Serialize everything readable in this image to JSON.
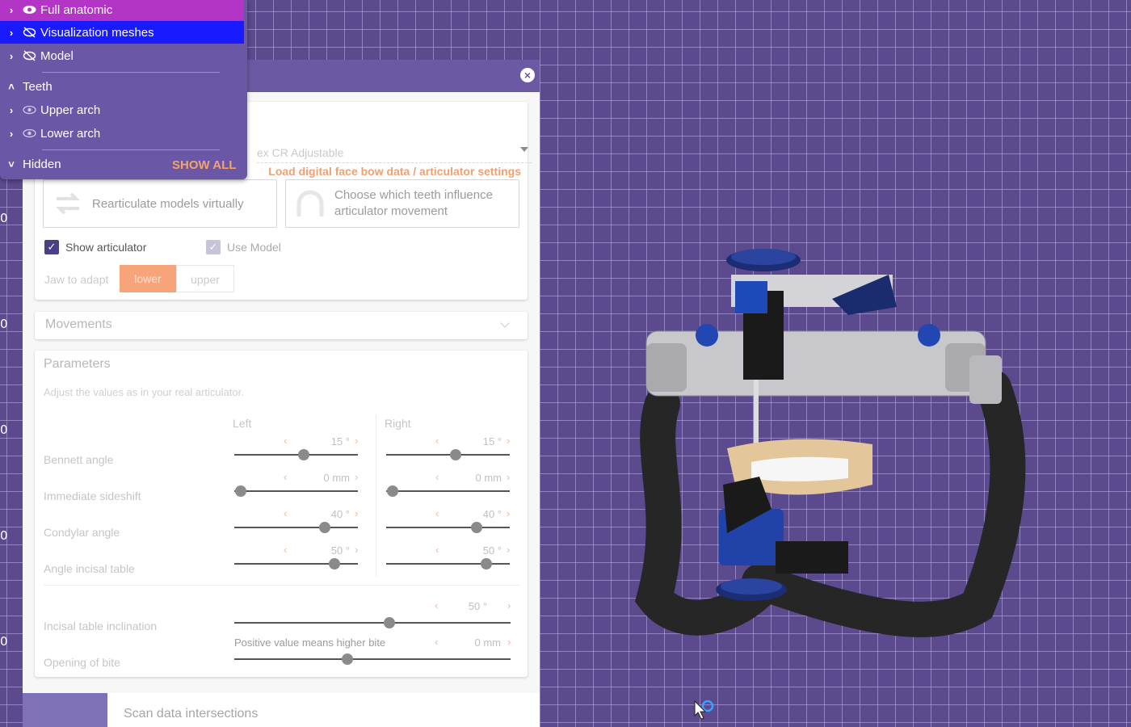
{
  "ruler_numbers": [
    "0",
    "0",
    "0",
    "0",
    "0"
  ],
  "menu": {
    "items": [
      {
        "label": "Full anatomic",
        "visible": true,
        "state": "magenta-highlight"
      },
      {
        "label": "Visualization meshes",
        "visible": false,
        "state": "selected"
      },
      {
        "label": "Model",
        "visible": false
      }
    ],
    "teeth_header": "Teeth",
    "teeth_items": [
      {
        "label": "Upper arch",
        "visible": true
      },
      {
        "label": "Lower arch",
        "visible": true
      }
    ],
    "hidden_header": "Hidden",
    "show_all": "SHOW ALL"
  },
  "panel": {
    "articulator_select": "ex CR Adjustable",
    "load_link": "Load digital face bow data / articulator settings",
    "rearticulate_button": "Rearticulate models virtually",
    "choose_teeth_button": "Choose which teeth influence articulator movement",
    "show_articulator": {
      "label": "Show articulator",
      "checked": true
    },
    "use_model": {
      "label": "Use Model",
      "checked": true
    },
    "jaw_to_adapt": "Jaw to adapt",
    "jaw_lower": "lower",
    "jaw_upper": "upper",
    "movements_title": "Movements",
    "parameters_title": "Parameters",
    "parameters_hint": "Adjust the values as in your real articulator.",
    "left_header": "Left",
    "right_header": "Right",
    "rows": [
      {
        "label": "Bennett angle",
        "left": "15 °",
        "right": "15 °",
        "left_frac": 0.56,
        "right_frac": 0.56
      },
      {
        "label": "Immediate sideshift",
        "left": "0 mm",
        "right": "0 mm",
        "left_frac": 0.05,
        "right_frac": 0.05
      },
      {
        "label": "Condylar angle",
        "left": "40 °",
        "right": "40 °",
        "left_frac": 0.73,
        "right_frac": 0.73
      },
      {
        "label": "Angle incisal table",
        "left": "50 °",
        "right": "50 °",
        "left_frac": 0.81,
        "right_frac": 0.81
      }
    ],
    "incisal_inclination": {
      "label": "Incisal table inclination",
      "value": "50 °",
      "frac": 0.56
    },
    "opening_of_bite": {
      "label": "Opening of bite",
      "hint": "Positive value means higher bite",
      "value": "0 mm",
      "frac": 0.41
    },
    "bottom_tab": "Scan data intersections"
  },
  "colors": {
    "accent_orange": "#f3a36b",
    "menu_purple": "#6a57a6",
    "selected_blue": "#1a1aff",
    "magenta": "#b235c6"
  }
}
